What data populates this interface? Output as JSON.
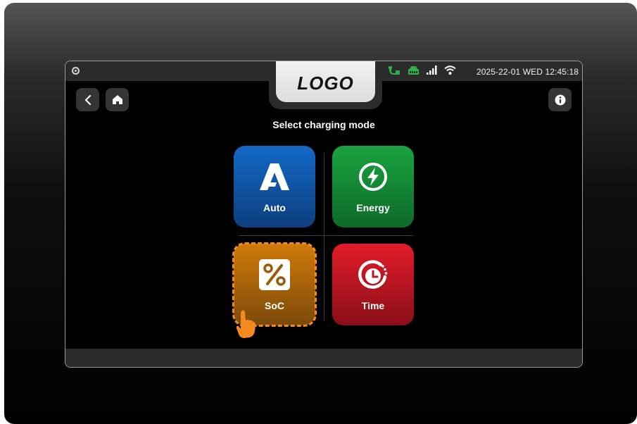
{
  "status": {
    "datetime": "2025-22-01 WED 12:45:18",
    "icons": [
      "camera-icon",
      "charging-cable-icon",
      "car-battery-icon",
      "signal-bars-icon",
      "wifi-icon"
    ]
  },
  "logo": {
    "text": "LOGO"
  },
  "nav": {
    "back_icon": "back-chevron-icon",
    "home_icon": "home-icon",
    "info_icon": "info-icon"
  },
  "main": {
    "title": "Select charging mode",
    "modes": [
      {
        "label": "Auto",
        "icon": "auto-a-icon",
        "color": "#1369c6"
      },
      {
        "label": "Energy",
        "icon": "lightning-icon",
        "color": "#1aa33f"
      },
      {
        "label": "SoC",
        "icon": "percent-icon",
        "color": "#d17a0a",
        "selected": true
      },
      {
        "label": "Time",
        "icon": "timer-icon",
        "color": "#e21b2a"
      }
    ]
  },
  "colors": {
    "highlight": "#f58a1f",
    "panel": "#2b2b2b",
    "background": "#000000"
  }
}
